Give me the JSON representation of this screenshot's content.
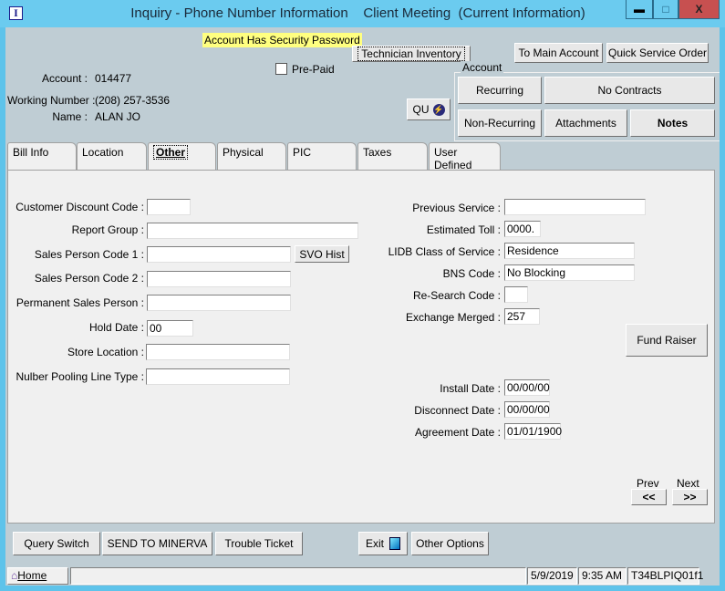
{
  "window": {
    "title": "Inquiry - Phone Number Information    Client Meeting  (Current Information)",
    "minimize": "▬",
    "maximize": "□",
    "close": "X"
  },
  "header": {
    "security_notice": "Account Has Security Password",
    "technician_inventory": "Technician Inventory",
    "to_main_account": "To Main Account",
    "quick_service_order": "Quick Service Order",
    "prepaid_label": "Pre-Paid",
    "prepaid_checked": false,
    "account_label": "Account :",
    "account_value": "014477",
    "working_number_label": "Working Number :",
    "working_number_value": "(208) 257-3536",
    "name_label": "Name :",
    "name_value": "ALAN JO",
    "qu_button": "QU"
  },
  "account_group": {
    "title": "Account",
    "recurring": "Recurring",
    "no_contracts": "No Contracts",
    "non_recurring": "Non-Recurring",
    "attachments": "Attachments",
    "notes": "Notes"
  },
  "tabs": [
    {
      "label": "Bill Info"
    },
    {
      "label": "Location"
    },
    {
      "label": "Other",
      "active": true
    },
    {
      "label": "Physical"
    },
    {
      "label": "PIC"
    },
    {
      "label": "Taxes"
    },
    {
      "label": "User Defined"
    }
  ],
  "left_fields": [
    {
      "label": "Customer Discount Code :",
      "value": ""
    },
    {
      "label": "Report Group :",
      "value": ""
    },
    {
      "label": "Sales Person Code 1 :",
      "value": ""
    },
    {
      "label": "Sales Person Code 2 :",
      "value": ""
    },
    {
      "label": "Permanent Sales Person :",
      "value": ""
    },
    {
      "label": "Hold Date :",
      "value": "00"
    },
    {
      "label": "Store Location :",
      "value": ""
    },
    {
      "label": "Nulber Pooling Line Type :",
      "value": ""
    }
  ],
  "svo_hist": "SVO Hist",
  "right_fields": [
    {
      "label": "Previous Service :",
      "value": ""
    },
    {
      "label": "Estimated Toll :",
      "value": "0000."
    },
    {
      "label": "LIDB Class of Service :",
      "value": "Residence"
    },
    {
      "label": "BNS Code :",
      "value": "No Blocking"
    },
    {
      "label": "Re-Search Code :",
      "value": ""
    },
    {
      "label": "Exchange Merged :",
      "value": "257"
    },
    {
      "label": "Install Date :",
      "value": "00/00/00"
    },
    {
      "label": "Disconnect Date :",
      "value": "00/00/00"
    },
    {
      "label": "Agreement Date :",
      "value": "01/01/1900"
    }
  ],
  "fund_raiser": "Fund Raiser",
  "nav": {
    "prev_label": "Prev",
    "next_label": "Next",
    "prev_button": "<<",
    "next_button": ">>"
  },
  "footer": {
    "query_switch": "Query Switch",
    "send_to_minerva": "SEND TO MINERVA",
    "trouble_ticket": "Trouble Ticket",
    "exit": "Exit",
    "other_options": "Other Options"
  },
  "status": {
    "home": "Home",
    "message": "",
    "date": "5/9/2019",
    "time": "9:35 AM",
    "code": "T34BLPIQ01f1"
  }
}
